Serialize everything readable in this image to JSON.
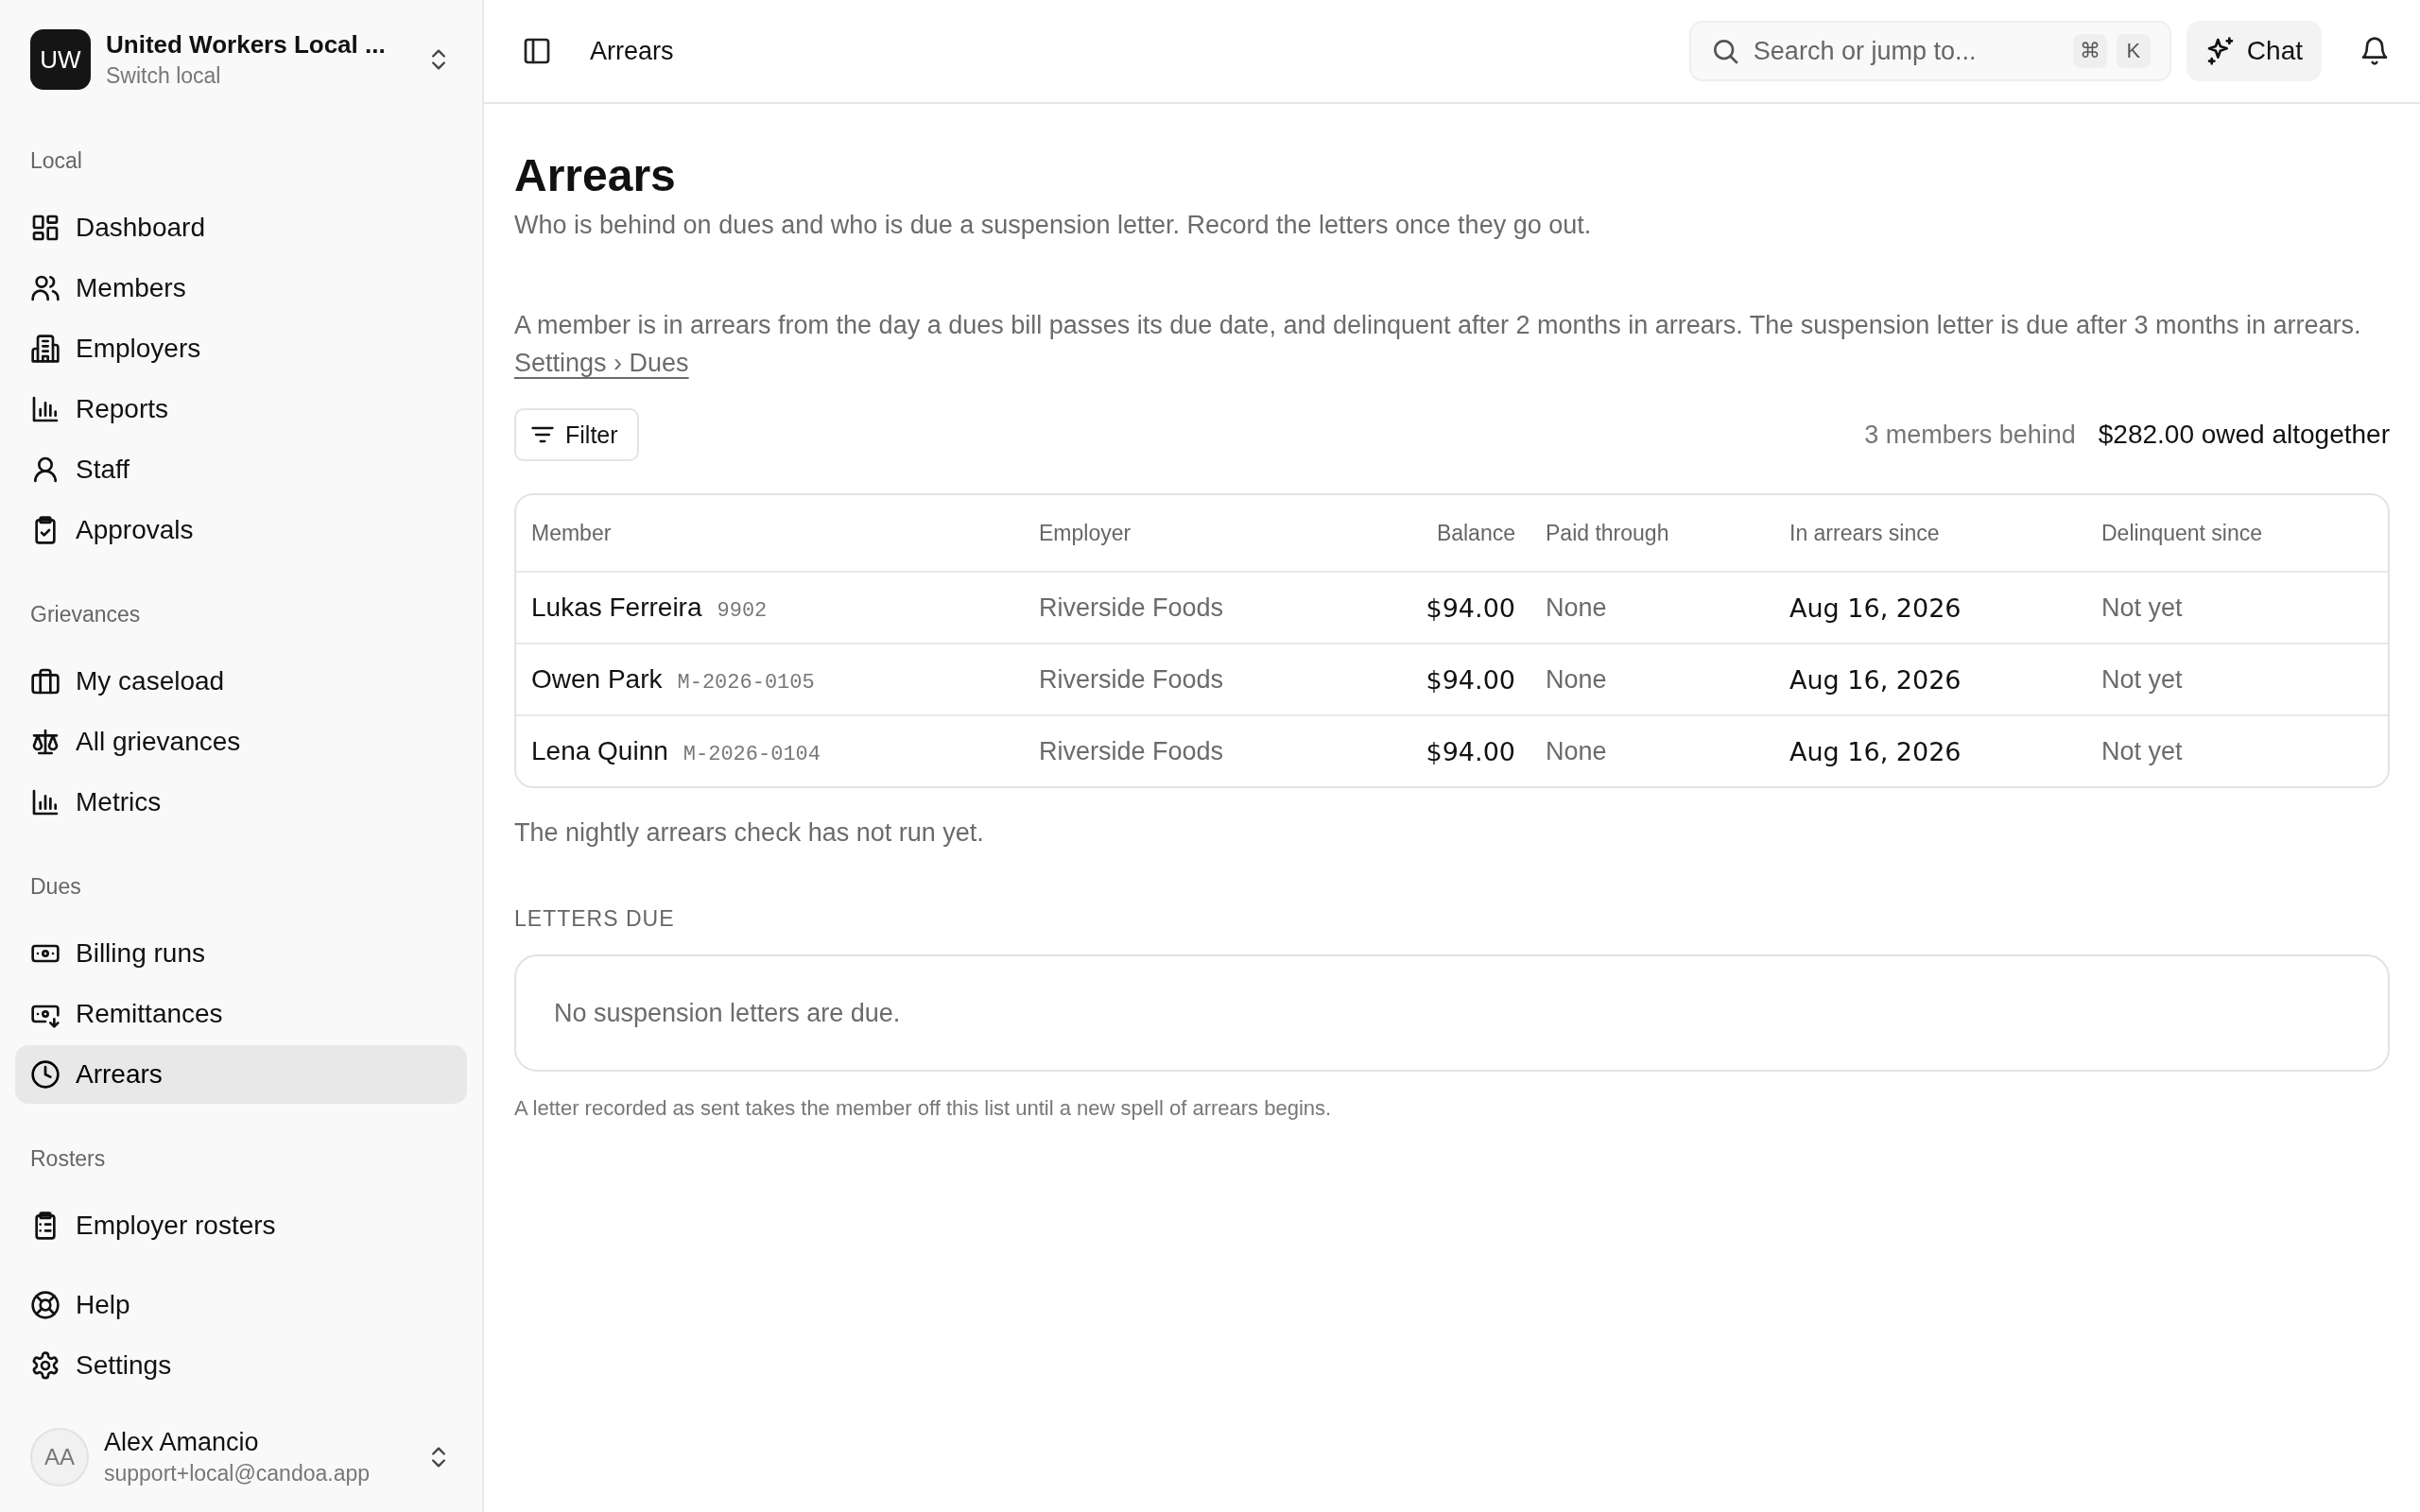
{
  "sidebar": {
    "org": {
      "initials": "UW",
      "name": "United Workers Local ...",
      "subtitle": "Switch local"
    },
    "sections": [
      {
        "title": "Local",
        "items": [
          {
            "label": "Dashboard",
            "selected": false
          },
          {
            "label": "Members",
            "selected": false
          },
          {
            "label": "Employers",
            "selected": false
          },
          {
            "label": "Reports",
            "selected": false
          },
          {
            "label": "Staff",
            "selected": false
          },
          {
            "label": "Approvals",
            "selected": false
          }
        ]
      },
      {
        "title": "Grievances",
        "items": [
          {
            "label": "My caseload",
            "selected": false
          },
          {
            "label": "All grievances",
            "selected": false
          },
          {
            "label": "Metrics",
            "selected": false
          }
        ]
      },
      {
        "title": "Dues",
        "items": [
          {
            "label": "Billing runs",
            "selected": false
          },
          {
            "label": "Remittances",
            "selected": false
          },
          {
            "label": "Arrears",
            "selected": true
          }
        ]
      },
      {
        "title": "Rosters",
        "items": [
          {
            "label": "Employer rosters",
            "selected": false
          }
        ]
      }
    ],
    "footer_items": [
      {
        "label": "Help",
        "selected": false
      },
      {
        "label": "Settings",
        "selected": false
      }
    ],
    "user": {
      "initials": "AA",
      "name": "Alex Amancio",
      "email": "support+local@candoa.app"
    }
  },
  "header": {
    "breadcrumb": "Arrears",
    "search": {
      "placeholder": "Search or jump to...",
      "shortcut": [
        "⌘",
        "K"
      ]
    },
    "chat_button": "Chat"
  },
  "page": {
    "title": "Arrears",
    "subtitle": "Who is behind on dues and who is due a suspension letter. Record the letters once they go out.",
    "policy": {
      "text": "A member is in arrears from the day a dues bill passes its due date, and delinquent after 2 months in arrears. The suspension letter is due after 3 months in arrears.",
      "link": "Settings › Dues"
    },
    "filter_button": "Filter",
    "summary": {
      "count": "3 members behind",
      "total": "$282.00 owed altogether"
    }
  },
  "table": {
    "columns": [
      "Member",
      "Employer",
      "Balance",
      "Paid through",
      "In arrears since",
      "Delinquent since"
    ],
    "rows": [
      {
        "member": "Lukas Ferreira",
        "member_id": "9902",
        "employer": "Riverside Foods",
        "balance": "$94.00",
        "paid_through": "None",
        "arrears_since": "Aug 16, 2026",
        "delinquent_since": "Not yet"
      },
      {
        "member": "Owen Park",
        "member_id": "M-2026-0105",
        "employer": "Riverside Foods",
        "balance": "$94.00",
        "paid_through": "None",
        "arrears_since": "Aug 16, 2026",
        "delinquent_since": "Not yet"
      },
      {
        "member": "Lena Quinn",
        "member_id": "M-2026-0104",
        "employer": "Riverside Foods",
        "balance": "$94.00",
        "paid_through": "None",
        "arrears_since": "Aug 16, 2026",
        "delinquent_since": "Not yet"
      }
    ]
  },
  "status_note": "The nightly arrears check has not run yet.",
  "letters": {
    "heading": "LETTERS DUE",
    "empty": "No suspension letters are due.",
    "footnote": "A letter recorded as sent takes the member off this list until a new spell of arrears begins."
  }
}
